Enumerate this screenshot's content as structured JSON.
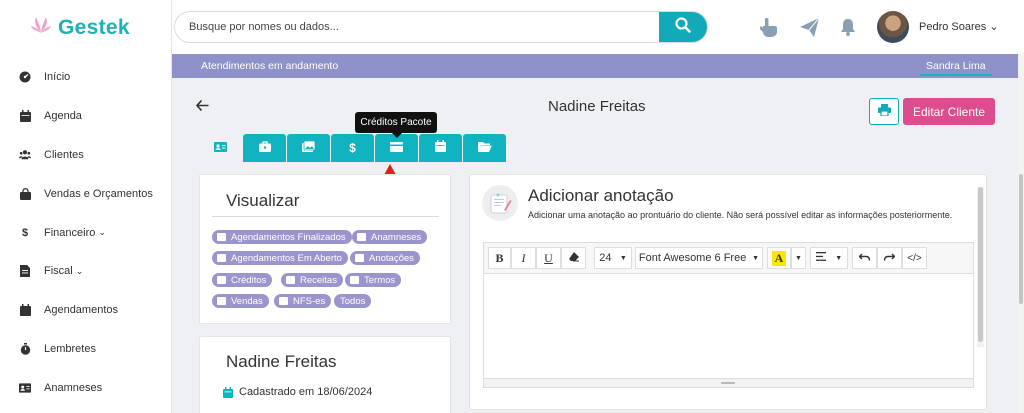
{
  "app": {
    "name": "Gestek",
    "brand_color": "#1fb1b5",
    "accent_color": "#12a9b8",
    "primary_button_color": "#dc4d8d",
    "strip_color": "#8f92c9"
  },
  "sidebar": {
    "items": [
      {
        "label": "Início",
        "icon": "dashboard-icon"
      },
      {
        "label": "Agenda",
        "icon": "calendar-icon"
      },
      {
        "label": "Clientes",
        "icon": "users-icon"
      },
      {
        "label": "Vendas e Orçamentos",
        "icon": "shopping-bag-icon"
      },
      {
        "label": "Financeiro",
        "icon": "dollar-icon",
        "chevron": "⌄"
      },
      {
        "label": "Fiscal",
        "icon": "receipt-icon",
        "chevron": "⌄"
      },
      {
        "label": "Agendamentos",
        "icon": "calendar-check-icon"
      },
      {
        "label": "Lembretes",
        "icon": "stopwatch-icon"
      },
      {
        "label": "Anamneses",
        "icon": "id-card-icon"
      }
    ]
  },
  "topbar": {
    "search_placeholder": "Busque por nomes ou dados...",
    "user_name": "Pedro Soares ⌄"
  },
  "strip": {
    "title": "Atendimentos em andamento",
    "user": "Sandra Lima"
  },
  "client": {
    "name": "Nadine Freitas",
    "edit_label": "Editar Cliente",
    "registered": "Cadastrado em 18/06/2024"
  },
  "tabs": {
    "icons": [
      "id-card-icon",
      "briefcase-icon",
      "images-icon",
      "dollar-icon",
      "credit-card-icon",
      "calendar-icon",
      "folder-open-icon"
    ],
    "tooltip": "Créditos Pacote"
  },
  "visualizar": {
    "title": "Visualizar",
    "filters": [
      "Agendamentos Finalizados",
      "Anamneses",
      "Agendamentos Em Aberto",
      "Anotações",
      "Créditos",
      "Receitas",
      "Termos",
      "Vendas",
      "NFS-es",
      "Todos"
    ]
  },
  "note": {
    "title": "Adicionar anotação",
    "subtitle": "Adicionar uma anotação ao prontuário do cliente. Não será possível editar as informações posteriormente.",
    "toolbar": {
      "bold": "B",
      "italic": "I",
      "underline": "U",
      "font_size": "24",
      "font_family": "Font Awesome 6 Free",
      "color_letter": "A",
      "code": "</>"
    }
  }
}
